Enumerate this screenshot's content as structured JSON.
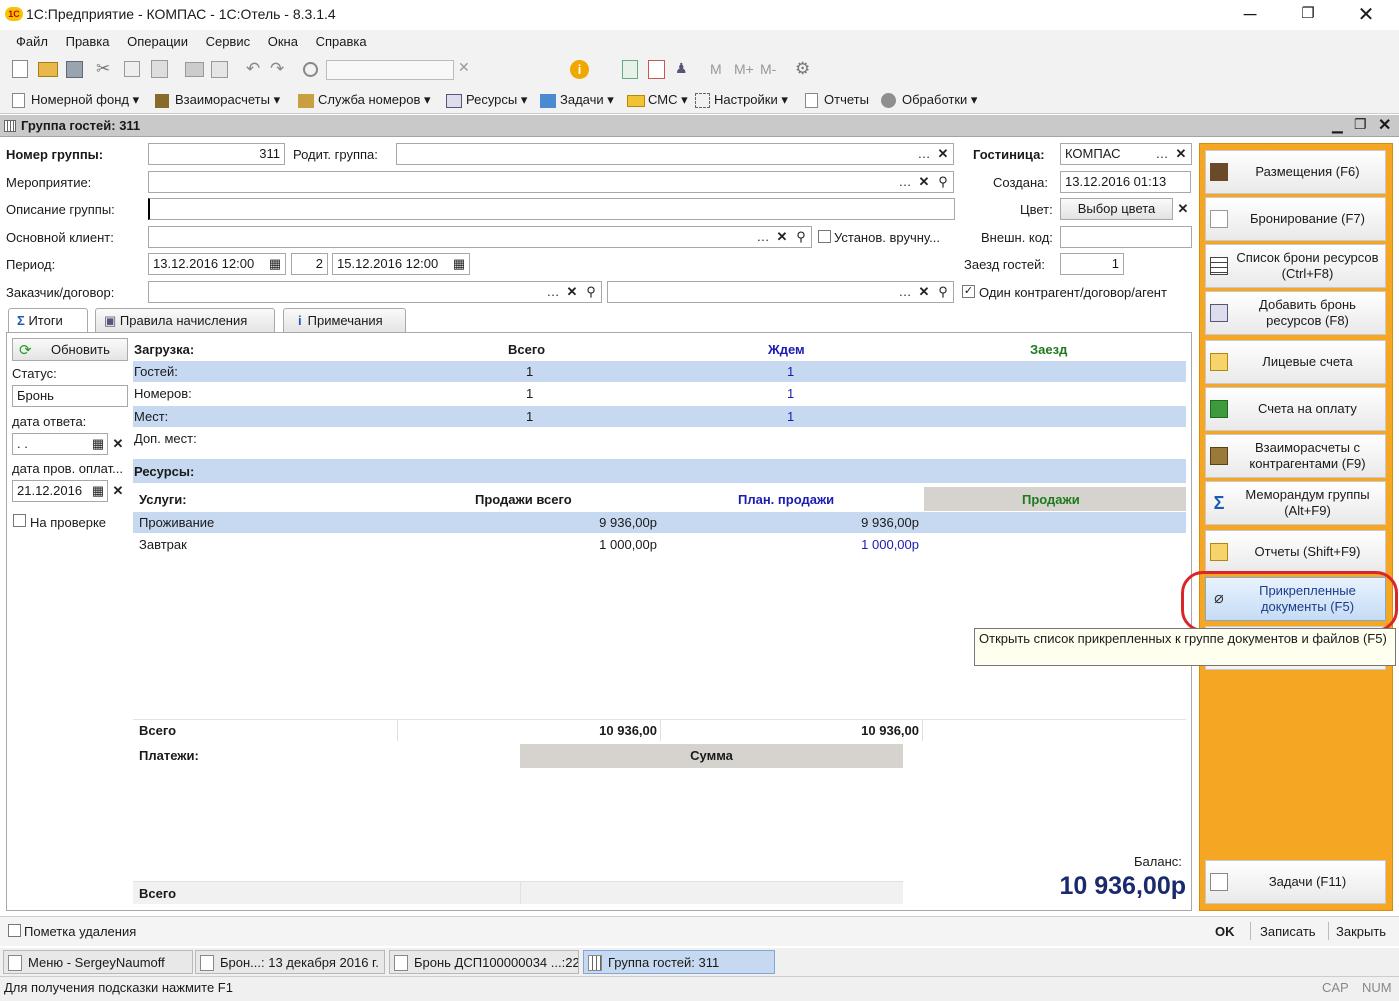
{
  "window": {
    "title": "1С:Предприятие - КОМПАС - 1С:Отель - 8.3.1.4"
  },
  "menu": [
    "Файл",
    "Правка",
    "Операции",
    "Сервис",
    "Окна",
    "Справка"
  ],
  "toolbar2": [
    "Номерной фонд",
    "Взаиморасчеты",
    "Служба номеров",
    "Ресурсы",
    "Задачи",
    "СМС",
    "Настройки",
    "Отчеты",
    "Обработки"
  ],
  "form": {
    "title": "Группа гостей: 311",
    "group_number_label": "Номер группы:",
    "group_number": "311",
    "parent_group_label": "Родит. группа:",
    "parent_group": "",
    "hotel_label": "Гостиница:",
    "hotel": "КОМПАС",
    "event_label": "Мероприятие:",
    "event": "",
    "created_label": "Создана:",
    "created": "13.12.2016 01:13",
    "description_label": "Описание группы:",
    "description": "",
    "color_label": "Цвет:",
    "color_button": "Выбор цвета",
    "client_label": "Основной клиент:",
    "client": "",
    "manual_label": "Установ. вручну...",
    "ext_code_label": "Внешн. код:",
    "ext_code": "",
    "period_label": "Период:",
    "period_from": "13.12.2016 12:00",
    "nights": "2",
    "period_to": "15.12.2016 12:00",
    "checkin_label": "Заезд гостей:",
    "checkin": "1",
    "customer_label": "Заказчик/договор:",
    "customer": "",
    "contract": "",
    "single_agent_label": "Один контрагент/договор/агент"
  },
  "tabs": [
    "Итоги",
    "Правила начисления",
    "Примечания"
  ],
  "left_panel": {
    "refresh": "Обновить",
    "status_label": "Статус:",
    "status": "Бронь",
    "answer_date_label": "дата ответа:",
    "answer_date": " .  .",
    "pay_check_label": "дата пров. оплат...",
    "pay_check_date": "21.12.2016",
    "on_check_label": "На проверке"
  },
  "load": {
    "header": [
      "Загрузка:",
      "Всего",
      "Ждем",
      "Заезд"
    ],
    "rows": [
      {
        "name": "Гостей:",
        "total": "1",
        "wait": "1"
      },
      {
        "name": "Номеров:",
        "total": "1",
        "wait": "1"
      },
      {
        "name": "Мест:",
        "total": "1",
        "wait": "1"
      },
      {
        "name": "Доп. мест:",
        "total": "",
        "wait": ""
      }
    ],
    "resources_label": "Ресурсы:"
  },
  "services": {
    "header": [
      "Услуги:",
      "Продажи всего",
      "План. продажи",
      "Продажи"
    ],
    "rows": [
      {
        "name": "Проживание",
        "total": "9 936,00р",
        "plan": "9 936,00р"
      },
      {
        "name": "Завтрак",
        "total": "1 000,00р",
        "plan": "1 000,00р"
      }
    ],
    "total_label": "Всего",
    "total": "10 936,00",
    "plan_total": "10 936,00"
  },
  "payments": {
    "label": "Платежи:",
    "sum_header": "Сумма",
    "total_label": "Всего"
  },
  "balance": {
    "label": "Баланс:",
    "value": "10 936,00р"
  },
  "right_buttons": [
    "Размещения (F6)",
    "Бронирование (F7)",
    "Список брони ресурсов (Ctrl+F8)",
    "Добавить бронь ресурсов (F8)",
    "Лицевые счета",
    "Счета на оплату",
    "Взаиморасчеты с контрагентами (F9)",
    "Меморандум группы (Alt+F9)",
    "Отчеты (Shift+F9)",
    "Прикрепленные документы (F5)",
    "Задачи (F11)"
  ],
  "tooltip": "Открыть список прикрепленных к группе документов и файлов (F5)",
  "bottom": {
    "deletion_mark": "Пометка удаления",
    "ok": "OK",
    "save": "Записать",
    "close": "Закрыть"
  },
  "taskbar": [
    "Меню - SergeyNaumoff",
    "Брон...: 13 декабря 2016 г.",
    "Бронь ДСП100000034 ...:22",
    "Группа гостей: 311"
  ],
  "status_bar": {
    "hint": "Для получения подсказки нажмите F1",
    "cap": "CAP",
    "num": "NUM"
  },
  "colors": {
    "accent": "#f5a623",
    "highlight_row": "#c6d9f1",
    "annotation": "#d9262b",
    "title_bar": "#c9c9c9",
    "link_blue": "#1c1cb4",
    "green": "#1f7a1f"
  }
}
